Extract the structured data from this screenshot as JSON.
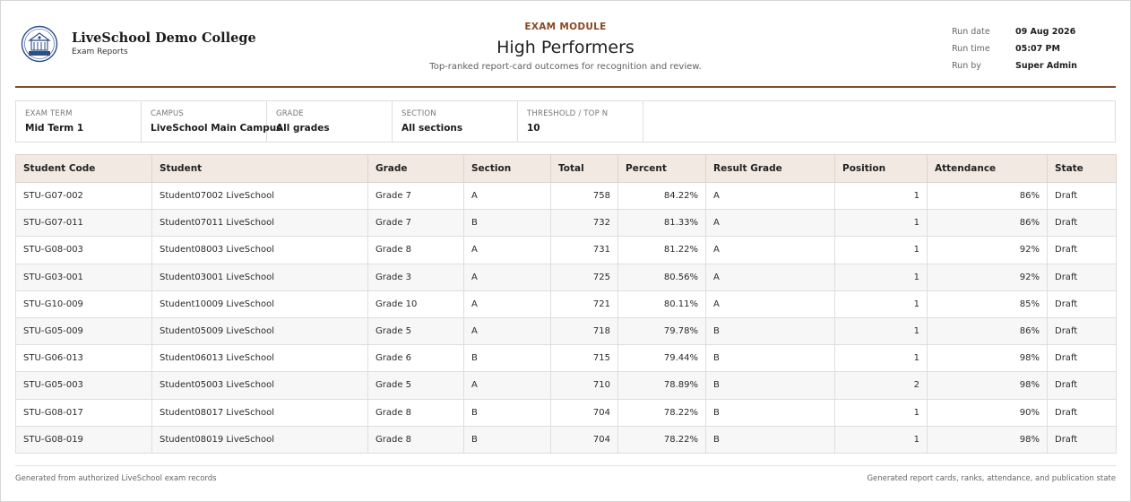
{
  "brand": {
    "name": "LiveSchool Demo College",
    "sub": "Exam Reports",
    "logo_icon": "school-crest-icon"
  },
  "report": {
    "module": "EXAM MODULE",
    "title": "High Performers",
    "subtitle": "Top-ranked report-card outcomes for recognition and review."
  },
  "run": {
    "date_label": "Run date",
    "date_value": "09 Aug 2026",
    "time_label": "Run time",
    "time_value": "05:07 PM",
    "by_label": "Run by",
    "by_value": "Super Admin"
  },
  "filters": [
    {
      "label": "EXAM TERM",
      "value": "Mid Term 1"
    },
    {
      "label": "CAMPUS",
      "value": "LiveSchool Main Campus"
    },
    {
      "label": "GRADE",
      "value": "All grades"
    },
    {
      "label": "SECTION",
      "value": "All sections"
    },
    {
      "label": "THRESHOLD / TOP N",
      "value": "10"
    }
  ],
  "table": {
    "headers": [
      "Student Code",
      "Student",
      "Grade",
      "Section",
      "Total",
      "Percent",
      "Result Grade",
      "Position",
      "Attendance",
      "State"
    ],
    "rows": [
      [
        "STU-G07-002",
        "Student07002 LiveSchool",
        "Grade 7",
        "A",
        "758",
        "84.22%",
        "A",
        "1",
        "86%",
        "Draft"
      ],
      [
        "STU-G07-011",
        "Student07011 LiveSchool",
        "Grade 7",
        "B",
        "732",
        "81.33%",
        "A",
        "1",
        "86%",
        "Draft"
      ],
      [
        "STU-G08-003",
        "Student08003 LiveSchool",
        "Grade 8",
        "A",
        "731",
        "81.22%",
        "A",
        "1",
        "92%",
        "Draft"
      ],
      [
        "STU-G03-001",
        "Student03001 LiveSchool",
        "Grade 3",
        "A",
        "725",
        "80.56%",
        "A",
        "1",
        "92%",
        "Draft"
      ],
      [
        "STU-G10-009",
        "Student10009 LiveSchool",
        "Grade 10",
        "A",
        "721",
        "80.11%",
        "A",
        "1",
        "85%",
        "Draft"
      ],
      [
        "STU-G05-009",
        "Student05009 LiveSchool",
        "Grade 5",
        "A",
        "718",
        "79.78%",
        "B",
        "1",
        "86%",
        "Draft"
      ],
      [
        "STU-G06-013",
        "Student06013 LiveSchool",
        "Grade 6",
        "B",
        "715",
        "79.44%",
        "B",
        "1",
        "98%",
        "Draft"
      ],
      [
        "STU-G05-003",
        "Student05003 LiveSchool",
        "Grade 5",
        "A",
        "710",
        "78.89%",
        "B",
        "2",
        "98%",
        "Draft"
      ],
      [
        "STU-G08-017",
        "Student08017 LiveSchool",
        "Grade 8",
        "B",
        "704",
        "78.22%",
        "B",
        "1",
        "90%",
        "Draft"
      ],
      [
        "STU-G08-019",
        "Student08019 LiveSchool",
        "Grade 8",
        "B",
        "704",
        "78.22%",
        "B",
        "1",
        "98%",
        "Draft"
      ]
    ]
  },
  "footer": {
    "left": "Generated from authorized LiveSchool exam records",
    "right": "Generated report cards, ranks, attendance, and publication state"
  },
  "colors": {
    "accent": "#8a4a24",
    "header_rule": "#7a4f33",
    "table_header_bg": "#f2e9e2",
    "logo_blue": "#2e4f86"
  }
}
